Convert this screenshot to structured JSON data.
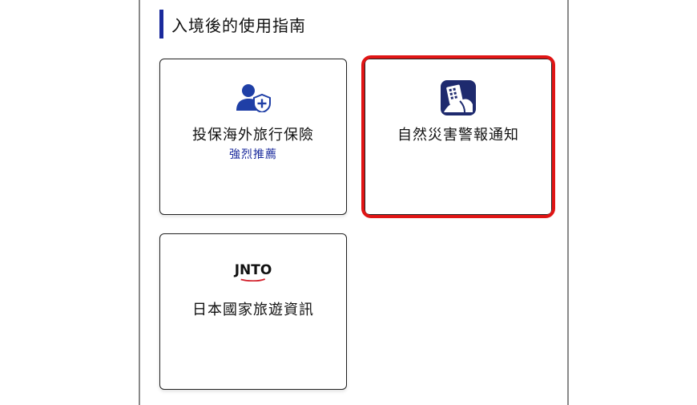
{
  "section": {
    "title": "入境後的使用指南"
  },
  "cards": {
    "insurance": {
      "label": "投保海外旅行保險",
      "sub": "強烈推薦",
      "icon": "person-shield-icon"
    },
    "alert": {
      "label": "自然災害警報通知",
      "icon": "disaster-alert-app-icon"
    },
    "jnto": {
      "logo": "JNTO",
      "label": "日本國家旅遊資訊",
      "icon": "jnto-logo"
    }
  },
  "colors": {
    "accent": "#1a2a9c",
    "highlight": "#e01515",
    "icon_blue": "#1f3fa6",
    "app_icon_bg": "#1e2a6e"
  }
}
